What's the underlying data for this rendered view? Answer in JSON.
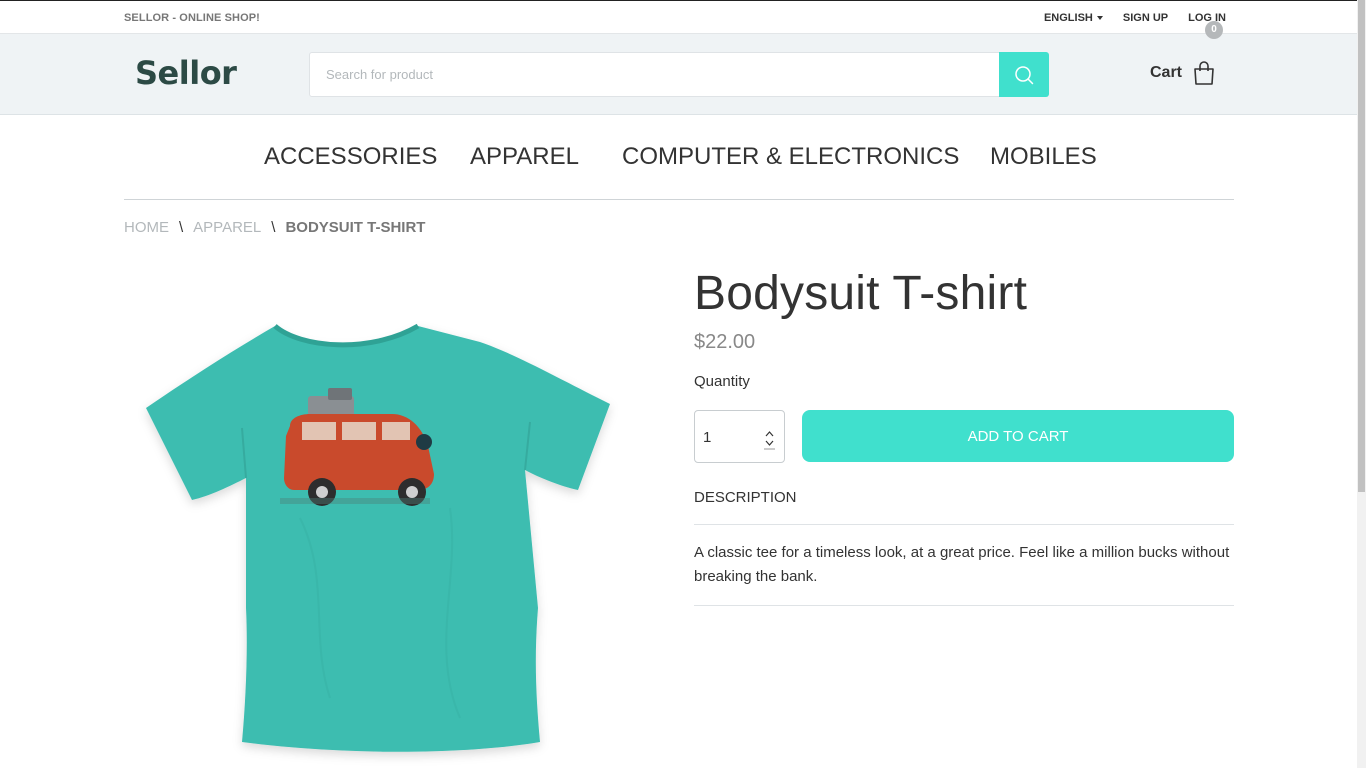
{
  "topbar": {
    "tagline": "SELLOR - ONLINE SHOP!",
    "language": "ENGLISH",
    "signup": "SIGN UP",
    "login": "LOG IN"
  },
  "header": {
    "logo": "Sellor",
    "search_placeholder": "Search for product",
    "cart_label": "Cart",
    "cart_count": "0"
  },
  "nav": {
    "items": [
      "ACCESSORIES",
      "APPAREL",
      "COMPUTER & ELECTRONICS",
      "MOBILES"
    ]
  },
  "breadcrumb": {
    "home": "HOME",
    "category": "APPAREL",
    "current": "BODYSUIT T-SHIRT",
    "separator": "\\"
  },
  "product": {
    "title": "Bodysuit T-shirt",
    "price": "$22.00",
    "quantity_label": "Quantity",
    "quantity_value": "1",
    "add_to_cart": "ADD TO CART",
    "description_heading": "DESCRIPTION",
    "description": "A classic tee for a timeless look, at a great price. Feel like a million bucks without breaking the bank.",
    "image_colors": {
      "shirt": "#3dbdb0",
      "van": "#c94a2c"
    }
  },
  "colors": {
    "accent": "#40e0cd",
    "header_bg": "#eff3f5",
    "logo": "#2c4a45"
  }
}
